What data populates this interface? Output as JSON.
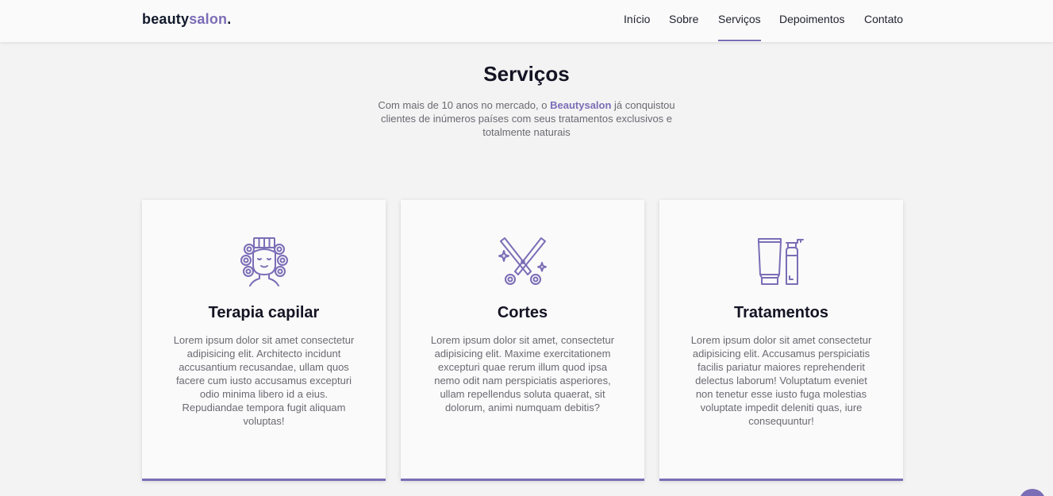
{
  "header": {
    "logo": {
      "main": "beauty",
      "accent": "salon",
      "dot": "."
    },
    "nav": [
      {
        "label": "Início",
        "active": false
      },
      {
        "label": "Sobre",
        "active": false
      },
      {
        "label": "Serviços",
        "active": true
      },
      {
        "label": "Depoimentos",
        "active": false
      },
      {
        "label": "Contato",
        "active": false
      }
    ]
  },
  "services": {
    "title": "Serviços",
    "intro": {
      "before": "Com mais de 10 anos no mercado, o ",
      "brand": "Beautysalon",
      "after": " já conquistou clientes de inúmeros países com seus tratamentos exclusivos e totalmente naturais"
    },
    "cards": [
      {
        "icon": "hair-rollers-icon",
        "title": "Terapia capilar",
        "text": "Lorem ipsum dolor sit amet consectetur adipisicing elit. Architecto incidunt accusantium recusandae, ullam quos facere cum iusto accusamus excepturi odio minima libero id a eius. Repudiandae tempora fugit aliquam voluptas!"
      },
      {
        "icon": "scissors-icon",
        "title": "Cortes",
        "text": "Lorem ipsum dolor sit amet, consectetur adipisicing elit. Maxime exercitationem excepturi quae rerum illum quod ipsa nemo odit nam perspiciatis asperiores, ullam repellendus soluta quaerat, sit dolorum, animi numquam debitis?"
      },
      {
        "icon": "cosmetic-bottles-icon",
        "title": "Tratamentos",
        "text": "Lorem ipsum dolor sit amet consectetur adipisicing elit. Accusamus perspiciatis facilis pariatur maiores reprehenderit delectus laborum! Voluptatum eveniet non tenetur esse iusto fuga molestias voluptate impedit deleniti quas, iure consequuntur!"
      }
    ]
  },
  "colors": {
    "accent": "#7b6db6",
    "background": "#f3f3f3",
    "card": "#fafafa",
    "heading": "#141424",
    "body_text": "#6a6a72"
  }
}
